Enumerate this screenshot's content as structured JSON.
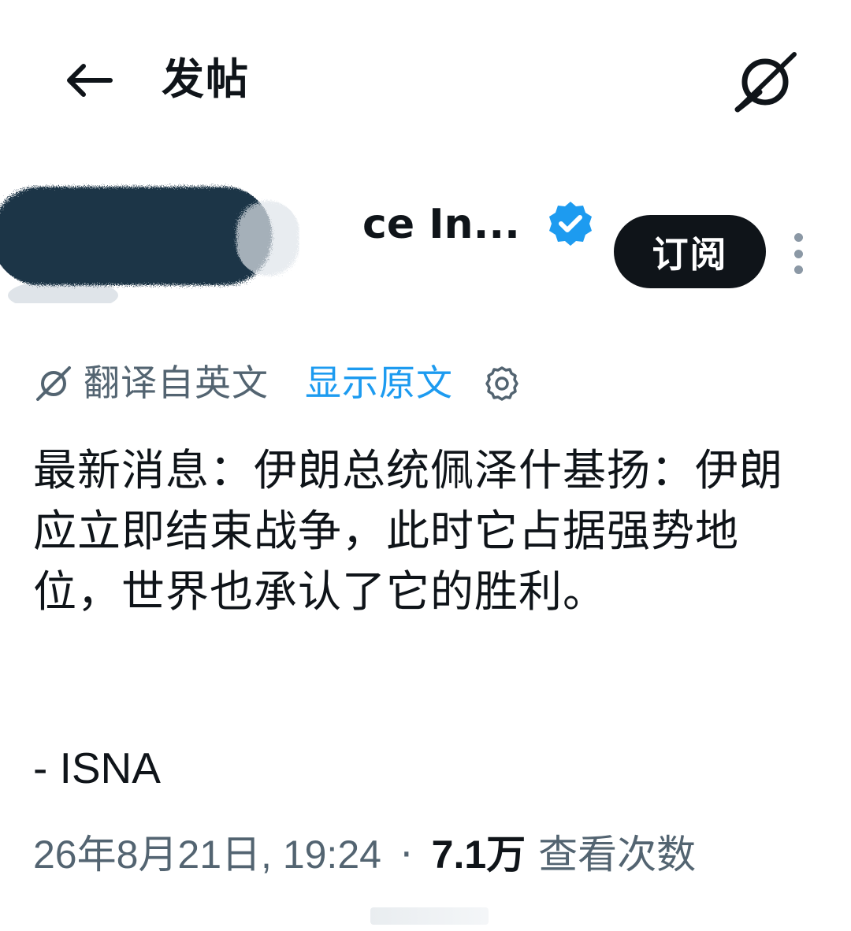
{
  "header": {
    "back_icon": "arrow-left-icon",
    "title": "发帖",
    "grok_icon": "grok-icon"
  },
  "author": {
    "name_visible": "ce In...",
    "verified_icon": "verified-badge-icon",
    "verified_color": "#1d9bf0",
    "subscribe_label": "订阅",
    "more_icon": "more-vertical-icon"
  },
  "translation": {
    "icon": "grok-icon",
    "label": "翻译自英文",
    "show_original": "显示原文",
    "settings_icon": "gear-icon"
  },
  "post": {
    "text": "最新消息：伊朗总统佩泽什基扬：伊朗应立即结束战争，此时它占据强势地位，世界也承认了它的胜利。",
    "source": "- ISNA"
  },
  "meta": {
    "timestamp": "26年8月21日, 19:24",
    "separator": "·",
    "views_count": "7.1万",
    "views_label": "查看次数"
  },
  "colors": {
    "text_primary": "#0f1419",
    "text_secondary": "#536471",
    "accent": "#1d9bf0",
    "button_bg": "#0f1419"
  }
}
